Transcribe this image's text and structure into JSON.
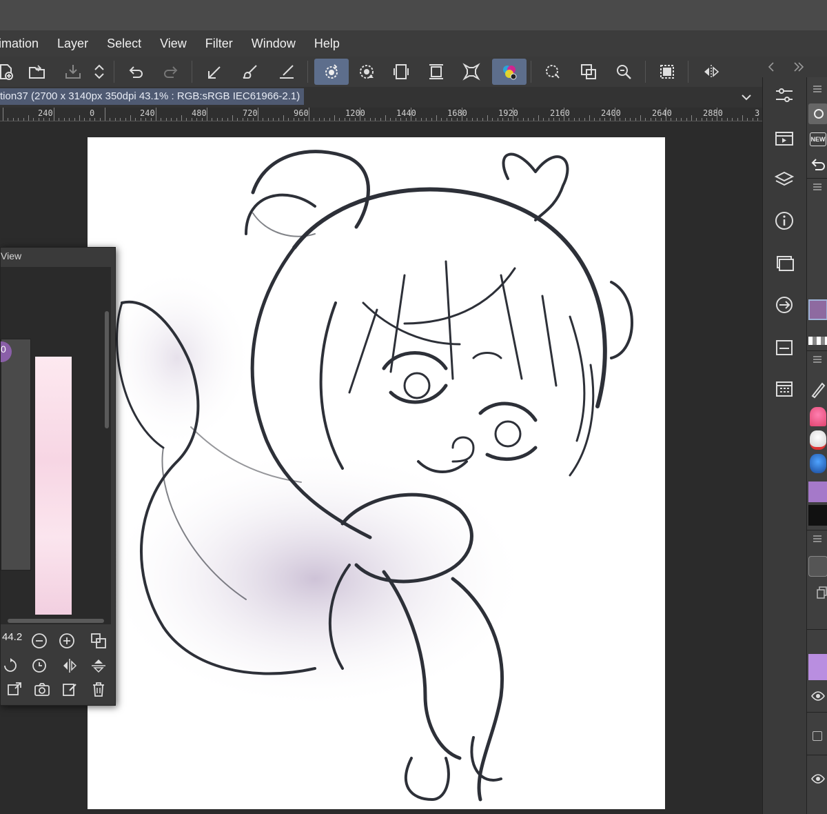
{
  "menubar": {
    "items": [
      "imation",
      "Layer",
      "Select",
      "View",
      "Filter",
      "Window",
      "Help"
    ]
  },
  "toolbar": {
    "icons": [
      "new-icon",
      "open-folder-icon",
      "save-icon",
      "stepper-icon",
      "undo-icon",
      "redo-icon",
      "transform-tool-icon",
      "brush-tool-icon",
      "line-tool-icon",
      "rotate-canvas-icon",
      "rotate-snap-icon",
      "fit-canvas-icon",
      "fit-width-icon",
      "scale-icon",
      "color-wheel-icon",
      "lasso-select-icon",
      "zoom-fit-icon",
      "zoom-icon",
      "select-all-icon",
      "flip-horizontal-icon"
    ]
  },
  "document": {
    "title": "tion37 (2700 x 3140px 350dpi 43.1% : RGB:sRGB IEC61966-2.1)"
  },
  "ruler": {
    "labels": [
      "240",
      "0",
      "240",
      "480",
      "720",
      "960",
      "1200",
      "1440",
      "1680",
      "1920",
      "2160",
      "2400",
      "2640",
      "2880",
      "3"
    ]
  },
  "navigator": {
    "title": "View",
    "zoom_value": "44.2",
    "color_value": "0",
    "color_value_suffix": "%"
  },
  "right_sidebar": {
    "icons": [
      "adjust-sliders-icon",
      "animation-timeline-icon",
      "material-layers-icon",
      "info-icon",
      "layer-panel-icon",
      "navigator-link-icon",
      "layer-property-icon",
      "subview-grid-icon"
    ]
  },
  "right_panel": {
    "new_badge": "NEW",
    "swatch_color": "#8e6aa0"
  },
  "colors": {
    "accent_active": "#5d6e8c",
    "doc_title_bg": "#4f5a72",
    "purple": "#8a5fa8"
  }
}
